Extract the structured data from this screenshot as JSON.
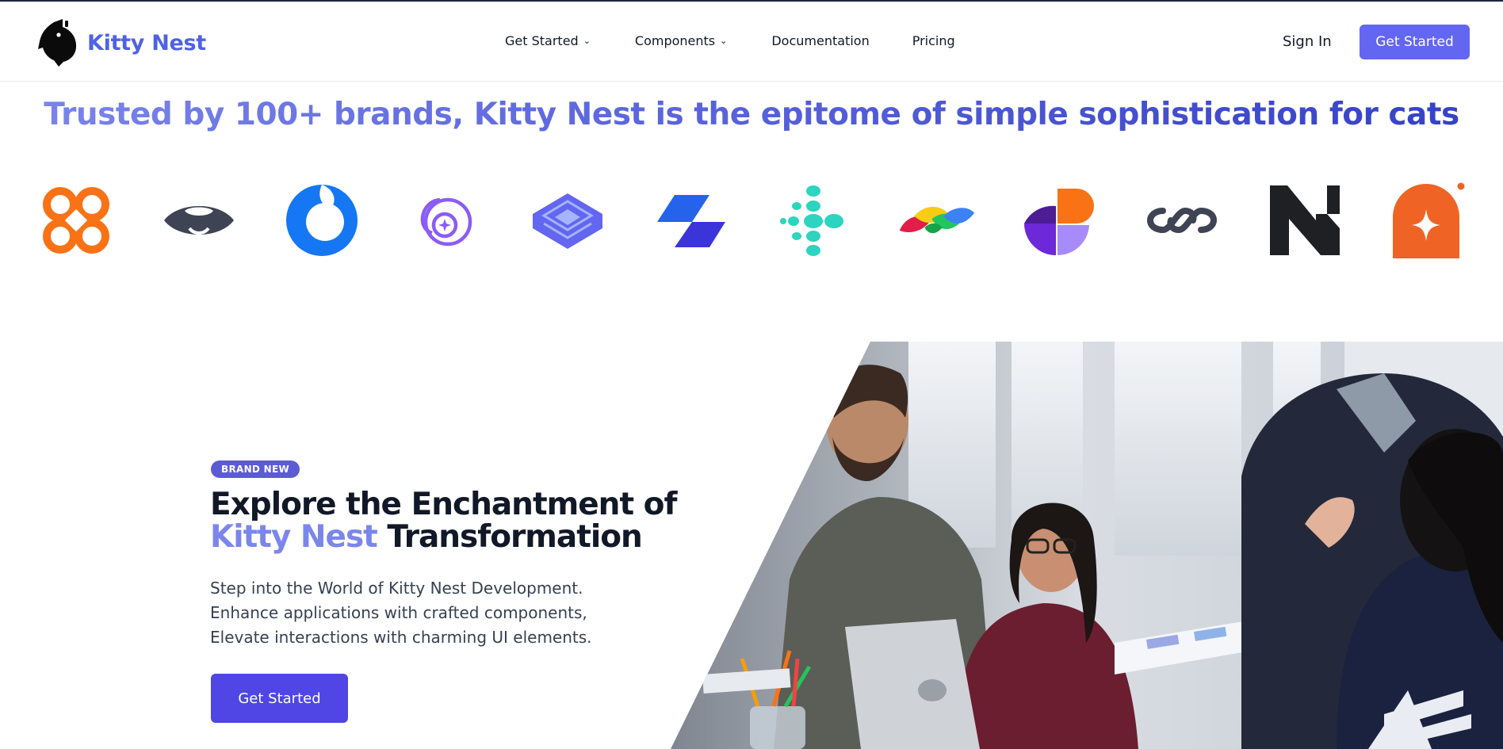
{
  "brand": {
    "name": "Kitty Nest",
    "logo_icon": "cat-silhouette-icon"
  },
  "nav": {
    "items": [
      {
        "label": "Get Started",
        "has_dropdown": true
      },
      {
        "label": "Components",
        "has_dropdown": true
      },
      {
        "label": "Documentation",
        "has_dropdown": false
      },
      {
        "label": "Pricing",
        "has_dropdown": false
      }
    ],
    "dropdown_icon": "⌄",
    "sign_in": "Sign In",
    "cta": "Get Started"
  },
  "trust": {
    "headline": "Trusted by 100+ brands, Kitty Nest is the epitome of simple sophistication for cats",
    "logos": [
      "orange-quatrefoil-logo",
      "dark-eye-logo",
      "blue-ring-logo",
      "purple-spiral-logo",
      "indigo-layers-logo",
      "blue-parallelogram-logo",
      "teal-dots-logo",
      "colorful-leaves-logo",
      "purple-orange-petals-logo",
      "dark-chain-logo",
      "black-n-logo",
      "orange-star-logo"
    ]
  },
  "hero": {
    "badge": "BRAND NEW",
    "title_line1": "Explore the Enchantment of",
    "title_accent": "Kitty Nest",
    "title_rest": "Transformation",
    "description": [
      "Step into the World of Kitty Nest Development.",
      "Enhance applications with crafted components,",
      "Elevate interactions with charming UI elements."
    ],
    "cta": "Get Started",
    "image_alt": "team-meeting-photo"
  },
  "colors": {
    "brand": "#4f62e6",
    "nav_cta": "#6366f1",
    "hero_cta": "#4f46e5",
    "accent": "#7b86ec",
    "badge": "#5b5bd6"
  }
}
